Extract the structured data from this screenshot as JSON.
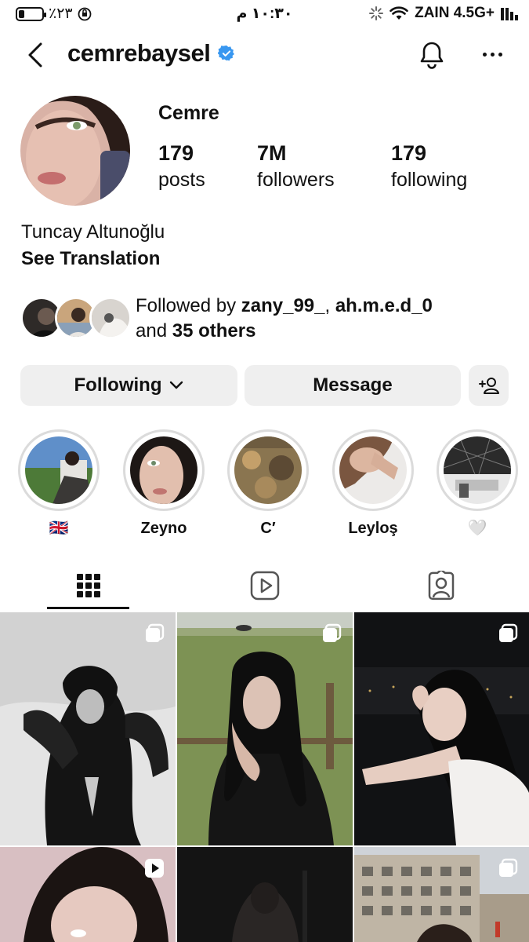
{
  "status_bar": {
    "battery_percent": "٪٢٣",
    "time": "١٠:٣٠ م",
    "carrier": "ZAIN 4.5G+"
  },
  "header": {
    "username": "cemrebaysel",
    "verified": true,
    "icons": [
      "back-arrow-icon",
      "verified-badge-icon",
      "bell-icon",
      "more-options-icon"
    ]
  },
  "profile": {
    "display_name": "Cemre",
    "stats": [
      {
        "value": "179",
        "label": "posts"
      },
      {
        "value": "7M",
        "label": "followers"
      },
      {
        "value": "179",
        "label": "following"
      }
    ],
    "bio": "Tuncay Altunoğlu",
    "translate_label": "See Translation"
  },
  "followed_by": {
    "prefix": "Followed by",
    "users": [
      "zany_99_",
      "ah.m.e.d_0"
    ],
    "separator": ",",
    "and": "and",
    "others": "35 others"
  },
  "actions": {
    "following_label": "Following",
    "message_label": "Message"
  },
  "highlights": [
    {
      "label": "🇬🇧"
    },
    {
      "label": "Zeyno"
    },
    {
      "label": "C′"
    },
    {
      "label": "Leyloş"
    },
    {
      "label": "🤍"
    }
  ],
  "tabs": [
    "grid-icon",
    "reels-icon",
    "tagged-icon"
  ],
  "posts": [
    {
      "type": "carousel"
    },
    {
      "type": "carousel"
    },
    {
      "type": "carousel"
    },
    {
      "type": "reel"
    },
    {
      "type": "none"
    },
    {
      "type": "carousel"
    }
  ],
  "colors": {
    "verified": "#3897f0",
    "button_bg": "#efefef",
    "highlight_ring": "#dbdbdb"
  }
}
